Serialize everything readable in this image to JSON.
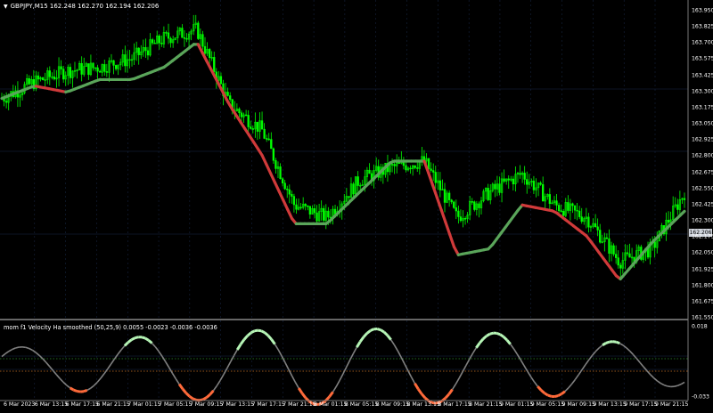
{
  "chart_header": {
    "symbol_line": "GBPJPY,M15  162.248 162.270 162.194 162.206",
    "current_price": "162.206"
  },
  "indicator": {
    "label": "mom f1 Velocity Ha smoothed (50,25,9) 0.0055 -0.0023 -0.0036 -0.0036",
    "axis_labels": [
      "0.018",
      "-0.033"
    ]
  },
  "price_axis": [
    "163.950",
    "163.825",
    "163.700",
    "163.575",
    "163.425",
    "163.300",
    "163.175",
    "163.050",
    "162.925",
    "162.800",
    "162.675",
    "162.550",
    "162.425",
    "162.300",
    "162.175",
    "162.050",
    "161.925",
    "161.800",
    "161.675",
    "161.550"
  ],
  "time_axis": [
    "6 Mar 2023",
    "6 Mar 13:15",
    "6 Mar 17:15",
    "6 Mar 21:15",
    "7 Mar 01:15",
    "7 Mar 05:15",
    "7 Mar 09:15",
    "7 Mar 13:15",
    "7 Mar 17:15",
    "7 Mar 21:15",
    "8 Mar 01:15",
    "8 Mar 05:15",
    "8 Mar 09:15",
    "8 Mar 13:15",
    "8 Mar 17:15",
    "8 Mar 21:15",
    "9 Mar 01:15",
    "9 Mar 05:15",
    "9 Mar 09:15",
    "9 Mar 13:15",
    "9 Mar 17:15",
    "9 Mar 21:15"
  ],
  "colors": {
    "background": "#000000",
    "candle": "#00ff00",
    "line_up": "#5aa55a",
    "line_down": "#d03a3a",
    "grid": "#1a2a4a",
    "osc_line": "#808080",
    "osc_up": "#b6f5b6",
    "osc_down": "#ff6a3a",
    "level_green": "#2e8b2e",
    "level_orange": "#c87020"
  },
  "chart_data": {
    "type": "line",
    "title": "GBPJPY,M15",
    "x": [
      "6 Mar 2023",
      "6 Mar 13:15",
      "6 Mar 17:15",
      "6 Mar 21:15",
      "7 Mar 01:15",
      "7 Mar 05:15",
      "7 Mar 09:15",
      "7 Mar 13:15",
      "7 Mar 17:15",
      "7 Mar 21:15",
      "8 Mar 01:15",
      "8 Mar 05:15",
      "8 Mar 09:15",
      "8 Mar 13:15",
      "8 Mar 17:15",
      "8 Mar 21:15",
      "9 Mar 01:15",
      "9 Mar 05:15",
      "9 Mar 09:15",
      "9 Mar 13:15",
      "9 Mar 17:15",
      "9 Mar 21:15"
    ],
    "ylim": [
      161.55,
      164.0
    ],
    "series": [
      {
        "values": [
          163.3,
          163.43,
          163.52,
          163.55,
          163.62,
          163.78,
          163.85,
          163.25,
          163.05,
          162.45,
          162.35,
          162.65,
          162.75,
          162.8,
          162.35,
          162.55,
          162.7,
          162.45,
          162.35,
          162.0,
          162.1,
          162.55
        ]
      },
      {
        "values": [
          163.3,
          163.4,
          163.35,
          163.45,
          163.45,
          163.55,
          163.75,
          163.25,
          162.85,
          162.3,
          162.3,
          162.55,
          162.8,
          162.8,
          162.05,
          162.1,
          162.45,
          162.4,
          162.2,
          161.85,
          162.15,
          162.4
        ]
      }
    ]
  }
}
